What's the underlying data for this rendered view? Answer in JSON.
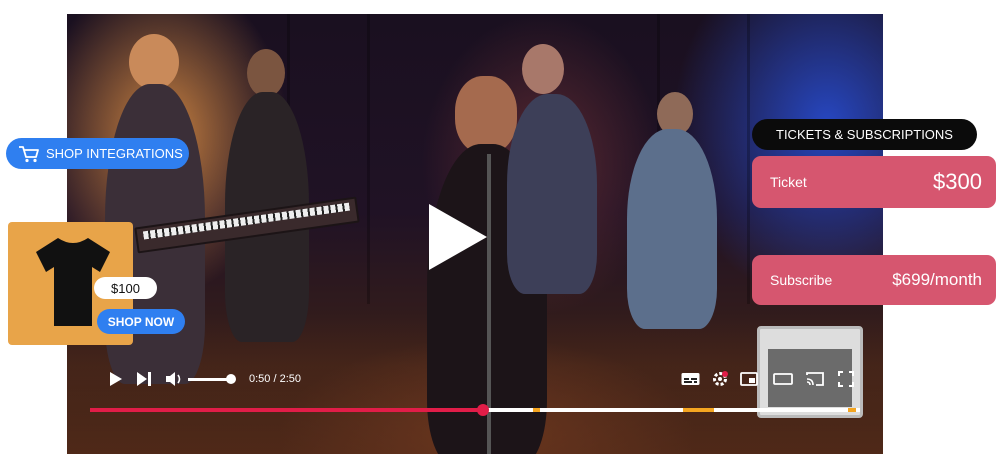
{
  "player": {
    "time": "0:50 / 2:50",
    "progress_fraction": 0.51,
    "volume_fraction": 0.9,
    "chapter_markers": [
      0.575,
      0.77,
      0.985
    ]
  },
  "shop": {
    "integrations_label": "SHOP INTEGRATIONS",
    "product_price": "$100",
    "shop_now_label": "SHOP NOW"
  },
  "tickets": {
    "header": "TICKETS & SUBSCRIPTIONS",
    "ticket_label": "Ticket",
    "ticket_price": "$300",
    "subscribe_label": "Subscribe",
    "subscribe_price": "$699/month"
  },
  "colors": {
    "accent_blue": "#2f7ff0",
    "offer_pink": "#d6566f",
    "progress_red": "#e11d48",
    "marker_yellow": "#f4a521",
    "product_bg": "#e8a449"
  }
}
